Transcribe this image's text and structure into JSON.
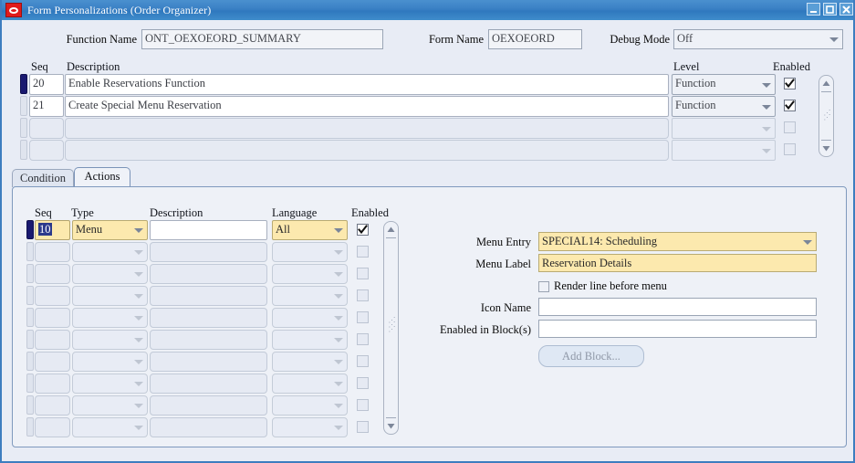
{
  "window": {
    "title": "Form Personalizations (Order Organizer)",
    "logo_icon": "oracle-logo-icon",
    "controls": [
      {
        "name": "minimize-button",
        "icon": "minimize-icon"
      },
      {
        "name": "maximize-button",
        "icon": "maximize-icon"
      },
      {
        "name": "close-button",
        "icon": "close-icon"
      }
    ]
  },
  "header": {
    "function_name_label": "Function Name",
    "function_name_value": "ONT_OEXOEORD_SUMMARY",
    "form_name_label": "Form Name",
    "form_name_value": "OEXOEORD",
    "debug_mode_label": "Debug Mode",
    "debug_mode_value": "Off"
  },
  "rules_grid": {
    "columns": [
      "Seq",
      "Description",
      "Level",
      "Enabled"
    ],
    "rows": [
      {
        "seq": "20",
        "description": "Enable Reservations Function",
        "level": "Function",
        "enabled": true,
        "current": true,
        "blank": false
      },
      {
        "seq": "21",
        "description": "Create Special Menu Reservation",
        "level": "Function",
        "enabled": true,
        "current": false,
        "blank": false
      },
      {
        "seq": "",
        "description": "",
        "level": "",
        "enabled": false,
        "current": false,
        "blank": true
      },
      {
        "seq": "",
        "description": "",
        "level": "",
        "enabled": false,
        "current": false,
        "blank": true
      }
    ]
  },
  "tabs": [
    {
      "label": "Condition",
      "active": false
    },
    {
      "label": "Actions",
      "active": true
    }
  ],
  "actions_grid": {
    "columns": [
      "Seq",
      "Type",
      "Description",
      "Language",
      "Enabled"
    ],
    "rows": [
      {
        "seq": "10",
        "type": "Menu",
        "description": "",
        "language": "All",
        "enabled": true,
        "current": true,
        "blank": false
      },
      {
        "seq": "",
        "type": "",
        "description": "",
        "language": "",
        "enabled": false,
        "current": false,
        "blank": true
      },
      {
        "seq": "",
        "type": "",
        "description": "",
        "language": "",
        "enabled": false,
        "current": false,
        "blank": true
      },
      {
        "seq": "",
        "type": "",
        "description": "",
        "language": "",
        "enabled": false,
        "current": false,
        "blank": true
      },
      {
        "seq": "",
        "type": "",
        "description": "",
        "language": "",
        "enabled": false,
        "current": false,
        "blank": true
      },
      {
        "seq": "",
        "type": "",
        "description": "",
        "language": "",
        "enabled": false,
        "current": false,
        "blank": true
      },
      {
        "seq": "",
        "type": "",
        "description": "",
        "language": "",
        "enabled": false,
        "current": false,
        "blank": true
      },
      {
        "seq": "",
        "type": "",
        "description": "",
        "language": "",
        "enabled": false,
        "current": false,
        "blank": true
      },
      {
        "seq": "",
        "type": "",
        "description": "",
        "language": "",
        "enabled": false,
        "current": false,
        "blank": true
      },
      {
        "seq": "",
        "type": "",
        "description": "",
        "language": "",
        "enabled": false,
        "current": false,
        "blank": true
      }
    ]
  },
  "action_detail": {
    "menu_entry_label": "Menu Entry",
    "menu_entry_value": "SPECIAL14: Scheduling",
    "menu_label_label": "Menu Label",
    "menu_label_value": "Reservation Details",
    "render_line_label": "Render line before menu",
    "render_line_checked": false,
    "icon_name_label": "Icon Name",
    "icon_name_value": "",
    "enabled_in_blocks_label": "Enabled in Block(s)",
    "enabled_in_blocks_value": "",
    "add_block_label": "Add Block..."
  },
  "colors": {
    "titlebar": "#3a80c4",
    "window_bg": "#e8ecf5",
    "required_field": "#fce9ae",
    "current_record": "#191970",
    "accent_border": "#3d7dbf"
  }
}
